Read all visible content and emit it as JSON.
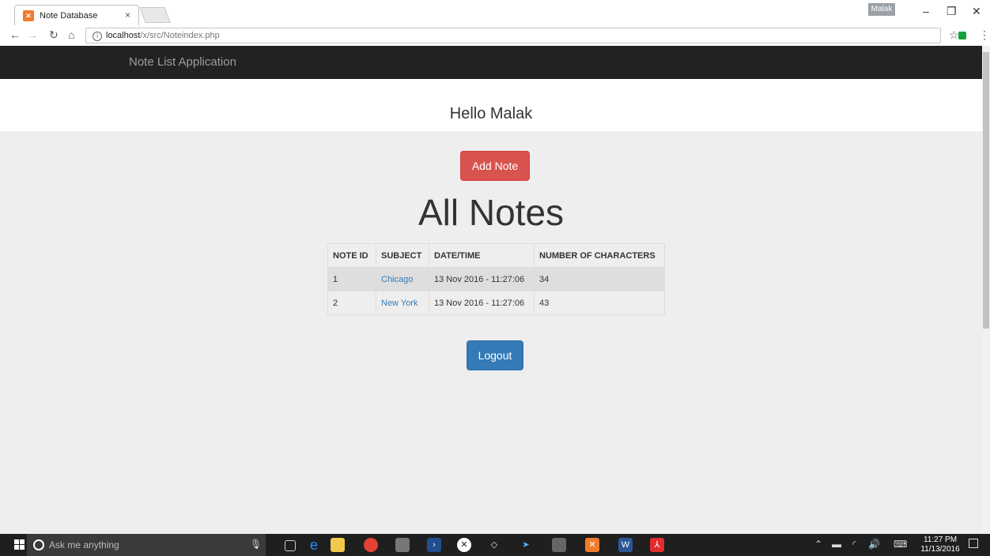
{
  "browser": {
    "tab_title": "Note Database",
    "tab_close": "×",
    "profile_name": "Malak",
    "url_host": "localhost",
    "url_path": "/x/src/Noteindex.php",
    "icons": [
      "back-icon",
      "forward-icon",
      "reload-icon",
      "home-icon",
      "info-icon",
      "star-icon",
      "extension-icon",
      "menu-icon"
    ]
  },
  "app": {
    "brand": "Note List Application",
    "greeting": "Hello Malak",
    "add_note_label": "Add Note",
    "heading": "All Notes",
    "logout_label": "Logout"
  },
  "table": {
    "headers": [
      "NOTE ID",
      "SUBJECT",
      "DATE/TIME",
      "NUMBER OF CHARACTERS"
    ],
    "rows": [
      {
        "id": "1",
        "subject": "Chicago",
        "datetime": "13 Nov 2016 - 11:27:06",
        "chars": "34"
      },
      {
        "id": "2",
        "subject": "New York",
        "datetime": "13 Nov 2016 - 11:27:06",
        "chars": "43"
      }
    ]
  },
  "taskbar": {
    "search_placeholder": "Ask me anything",
    "time": "11:27 PM",
    "date": "11/13/2016"
  },
  "colors": {
    "navbar": "#222222",
    "danger": "#d9534f",
    "primary": "#337ab7",
    "page_bg": "#eeeeee"
  }
}
